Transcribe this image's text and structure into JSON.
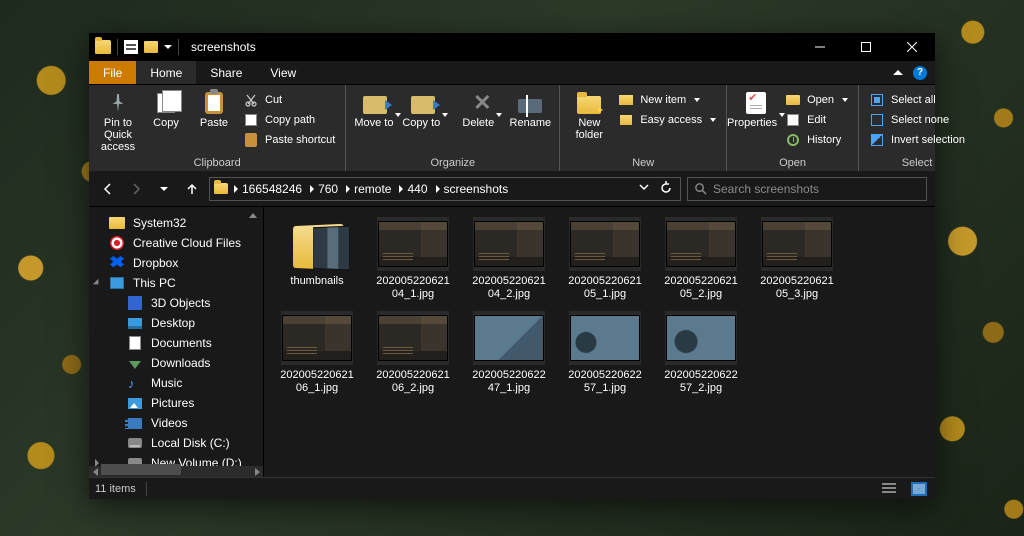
{
  "window": {
    "title": "screenshots"
  },
  "tabs": {
    "file": "File",
    "home": "Home",
    "share": "Share",
    "view": "View"
  },
  "ribbon": {
    "clipboard": {
      "label": "Clipboard",
      "pin": "Pin to Quick access",
      "copy": "Copy",
      "paste": "Paste",
      "cut": "Cut",
      "copy_path": "Copy path",
      "paste_shortcut": "Paste shortcut"
    },
    "organize": {
      "label": "Organize",
      "move_to": "Move to",
      "copy_to": "Copy to",
      "delete": "Delete",
      "rename": "Rename"
    },
    "new": {
      "label": "New",
      "new_folder": "New folder",
      "new_item": "New item",
      "easy_access": "Easy access"
    },
    "open": {
      "label": "Open",
      "properties": "Properties",
      "open": "Open",
      "edit": "Edit",
      "history": "History"
    },
    "select": {
      "label": "Select",
      "select_all": "Select all",
      "select_none": "Select none",
      "invert": "Invert selection"
    }
  },
  "breadcrumbs": [
    "166548246",
    "760",
    "remote",
    "440",
    "screenshots"
  ],
  "search": {
    "placeholder": "Search screenshots"
  },
  "sidebar": {
    "items": [
      {
        "name": "System32",
        "icon": "folder"
      },
      {
        "name": "Creative Cloud Files",
        "icon": "cc"
      },
      {
        "name": "Dropbox",
        "icon": "dropbox"
      },
      {
        "name": "This PC",
        "icon": "pc",
        "expandable": true
      },
      {
        "name": "3D Objects",
        "icon": "3d",
        "indent": true
      },
      {
        "name": "Desktop",
        "icon": "desktop",
        "indent": true
      },
      {
        "name": "Documents",
        "icon": "docs",
        "indent": true
      },
      {
        "name": "Downloads",
        "icon": "down",
        "indent": true
      },
      {
        "name": "Music",
        "icon": "music",
        "indent": true
      },
      {
        "name": "Pictures",
        "icon": "pics",
        "indent": true
      },
      {
        "name": "Videos",
        "icon": "video",
        "indent": true
      },
      {
        "name": "Local Disk (C:)",
        "icon": "drive",
        "indent": true
      },
      {
        "name": "New Volume (D:)",
        "icon": "drive",
        "indent": true,
        "expandable": true
      }
    ]
  },
  "items": [
    {
      "name": "thumbnails",
      "type": "folder"
    },
    {
      "name": "20200522062104_1.jpg",
      "type": "image",
      "variant": "dark"
    },
    {
      "name": "20200522062104_2.jpg",
      "type": "image",
      "variant": "dark"
    },
    {
      "name": "20200522062105_1.jpg",
      "type": "image",
      "variant": "dark"
    },
    {
      "name": "20200522062105_2.jpg",
      "type": "image",
      "variant": "dark"
    },
    {
      "name": "20200522062105_3.jpg",
      "type": "image",
      "variant": "dark"
    },
    {
      "name": "20200522062106_1.jpg",
      "type": "image",
      "variant": "dark"
    },
    {
      "name": "20200522062106_2.jpg",
      "type": "image",
      "variant": "dark"
    },
    {
      "name": "20200522062247_1.jpg",
      "type": "image",
      "variant": "v2"
    },
    {
      "name": "20200522062257_1.jpg",
      "type": "image",
      "variant": "v3"
    },
    {
      "name": "20200522062257_2.jpg",
      "type": "image",
      "variant": "v3b"
    }
  ],
  "status": {
    "count": "11 items"
  }
}
